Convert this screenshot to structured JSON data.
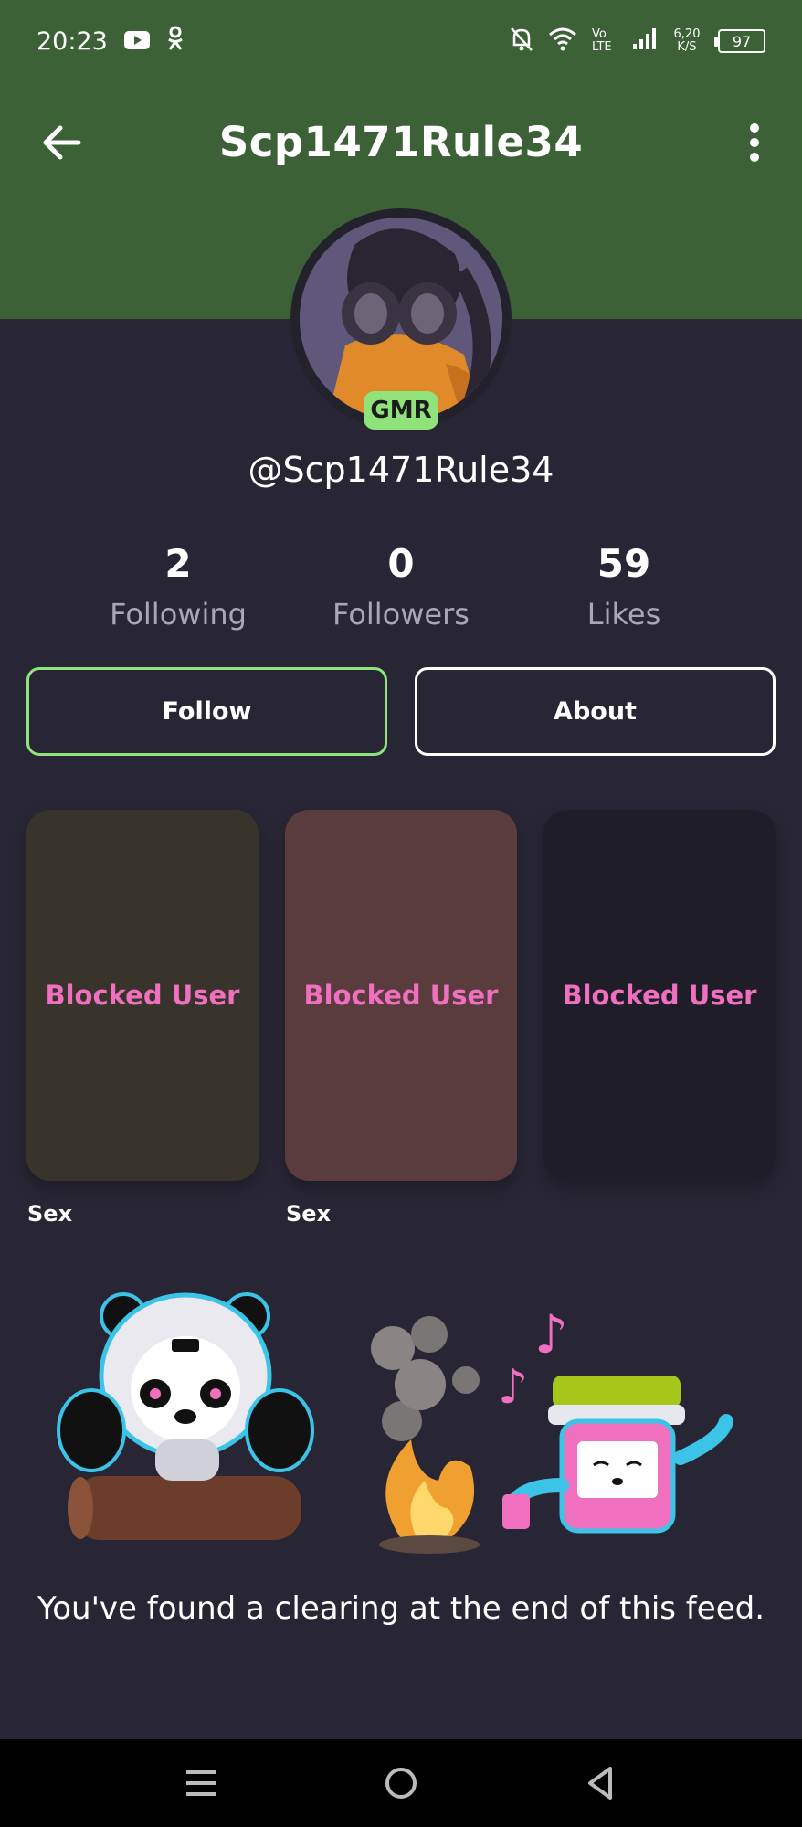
{
  "status_bar": {
    "time": "20:23",
    "network": "Vo LTE",
    "speed": "6,20 K/S",
    "battery": "97",
    "icons": [
      "youtube-icon",
      "ok-icon",
      "bell-off-icon",
      "wifi-icon",
      "signal-icon",
      "battery-icon"
    ]
  },
  "header": {
    "title": "Scp1471Rule34",
    "back_icon": "arrow-left-icon",
    "more_icon": "more-vertical-icon",
    "bg_color": "#3d6136"
  },
  "profile": {
    "badge": "GMR",
    "handle": "@Scp1471Rule34",
    "accent_color": "#8fe37a"
  },
  "stats": [
    {
      "value": "2",
      "label": "Following"
    },
    {
      "value": "0",
      "label": "Followers"
    },
    {
      "value": "59",
      "label": "Likes"
    }
  ],
  "actions": {
    "follow_label": "Follow",
    "about_label": "About"
  },
  "posts": [
    {
      "overlay": "Blocked User",
      "caption": "Sex",
      "bg": "#38342b"
    },
    {
      "overlay": "Blocked User",
      "caption": "Sex",
      "bg": "#5a3c3f"
    },
    {
      "overlay": "Blocked User",
      "caption": "",
      "bg": "#1f1e28"
    }
  ],
  "feed_end": {
    "message": "You've found a clearing at the end of this feed."
  },
  "nav": {
    "icons": [
      "menu-icon",
      "home-circle-icon",
      "back-triangle-icon"
    ]
  }
}
